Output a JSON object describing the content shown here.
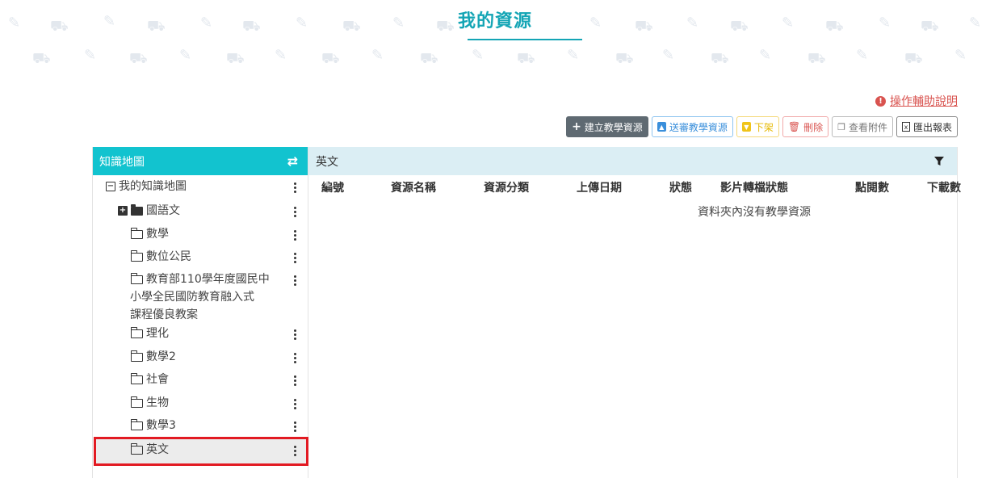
{
  "page_title": "我的資源",
  "help_link": "操作輔助說明",
  "toolbar": {
    "create": "建立教學資源",
    "submit": "送審教學資源",
    "unpublish": "下架",
    "delete": "刪除",
    "view_attachments": "查看附件",
    "export_report": "匯出報表"
  },
  "tree": {
    "header": "知識地圖",
    "root": "我的知識地圖",
    "items": [
      {
        "label": "國語文"
      },
      {
        "label": "數學"
      },
      {
        "label": "數位公民"
      },
      {
        "label_line1": "教育部110學年度國民中",
        "label_line2": "小學全民國防教育融入式",
        "label_line3": "課程優良教案"
      },
      {
        "label": "理化"
      },
      {
        "label": "數學2"
      },
      {
        "label": "社會"
      },
      {
        "label": "生物"
      },
      {
        "label": "數學3"
      },
      {
        "label": "英文"
      }
    ]
  },
  "content": {
    "folder_name": "英文",
    "columns": [
      "編號",
      "資源名稱",
      "資源分類",
      "上傳日期",
      "狀態",
      "影片轉檔狀態",
      "點閱數",
      "下載數"
    ],
    "empty_message": "資料夾內沒有教學資源"
  },
  "colors": {
    "accent": "#14a5b5",
    "tree_header": "#12c3cf",
    "content_header": "#dbeef4",
    "highlight": "#e21a22"
  }
}
